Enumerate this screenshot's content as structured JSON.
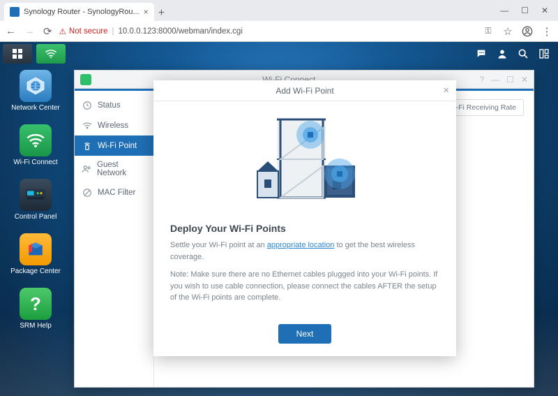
{
  "browser": {
    "tab_title": "Synology Router - SynologyRou...",
    "not_secure_label": "Not secure",
    "url": "10.0.0.123:8000/webman/index.cgi"
  },
  "desktop_icons": {
    "network_center": "Network Center",
    "wifi_connect": "Wi-Fi Connect",
    "control_panel": "Control Panel",
    "package_center": "Package Center",
    "srm_help": "SRM Help"
  },
  "appwin": {
    "title": "Wi-Fi Connect",
    "sidenav": {
      "status": "Status",
      "wireless": "Wireless",
      "wifi_point": "Wi-Fi Point",
      "guest_network": "Guest Network",
      "mac_filter": "MAC Filter"
    },
    "rate_pill": "Wi-Fi Receiving Rate"
  },
  "modal": {
    "title": "Add Wi-Fi Point",
    "heading": "Deploy Your Wi-Fi Points",
    "line1_a": "Settle your Wi-Fi point at an ",
    "line1_link": "appropriate location",
    "line1_b": " to get the best wireless coverage.",
    "note": "Note: Make sure there are no Ethernet cables plugged into your Wi-Fi points. If you wish to use cable connection, please connect the cables AFTER the setup of the Wi-Fi points are complete.",
    "next": "Next"
  }
}
